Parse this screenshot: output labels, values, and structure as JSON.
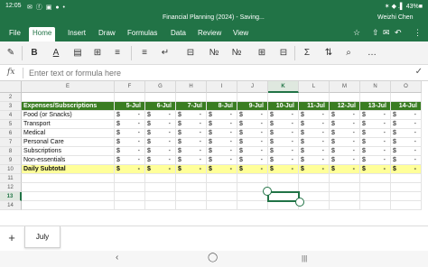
{
  "status": {
    "time": "12:05",
    "icons": "✉ ⓕ ▣ ● •",
    "right": "✶ ◆ .▌ 43%■"
  },
  "title": {
    "doc": "Financial Planning (2024) - Saving...",
    "user": "Weizhi Chen"
  },
  "tabs": [
    "File",
    "Home",
    "Insert",
    "Draw",
    "Formulas",
    "Data",
    "Review",
    "View"
  ],
  "active_tab": "Home",
  "toolbar_icons": {
    "lightbulb": "☆",
    "share": "⇧",
    "comment": "✉",
    "undo": "↶",
    "more": "⋮",
    "paint": "✎",
    "bold": "B",
    "underline": "A",
    "fill": "▤",
    "borders": "⊞",
    "align": "≡",
    "wrap": "↵",
    "merge": "⊟",
    "number": "№",
    "insert": "⊞",
    "delete": "⊟",
    "sum": "Σ",
    "sort": "⇅",
    "find": "⌕",
    "more2": "…"
  },
  "formula_bar": {
    "fx": "fx",
    "placeholder": "Enter text or formula here",
    "check": "✓"
  },
  "columns": [
    "E",
    "F",
    "G",
    "H",
    "I",
    "J",
    "K",
    "L",
    "M",
    "N",
    "O"
  ],
  "selected_column": "K",
  "rows": [
    "2",
    "3",
    "4",
    "5",
    "6",
    "7",
    "8",
    "9",
    "10",
    "11",
    "12",
    "13",
    "14"
  ],
  "selected_row": "13",
  "header_row": {
    "label": "Expenses/Subscriptions",
    "dates": [
      "5-Jul",
      "6-Jul",
      "7-Jul",
      "8-Jul",
      "9-Jul",
      "10-Jul",
      "11-Jul",
      "12-Jul",
      "13-Jul",
      "14-Jul"
    ]
  },
  "expense_rows": [
    {
      "label": "Food (or Snacks)",
      "cells": [
        "$ -",
        "$ -",
        "$ -",
        "$ -",
        "$ -",
        "$ -",
        "$ -",
        "$ -",
        "$ -",
        "$ -"
      ]
    },
    {
      "label": "Transport",
      "cells": [
        "$ -",
        "$ -",
        "$ -",
        "$ -",
        "$ -",
        "$ -",
        "$ -",
        "$ -",
        "$ -",
        "$ -"
      ]
    },
    {
      "label": "Medical",
      "cells": [
        "$ -",
        "$ -",
        "$ -",
        "$ -",
        "$ -",
        "$ -",
        "$ -",
        "$ -",
        "$ -",
        "$ -"
      ]
    },
    {
      "label": "Personal Care",
      "cells": [
        "$ -",
        "$ -",
        "$ -",
        "$ -",
        "$ -",
        "$ -",
        "$ -",
        "$ -",
        "$ -",
        "$ -"
      ]
    },
    {
      "label": "Subscriptions",
      "cells": [
        "$ -",
        "$ -",
        "$ -",
        "$ -",
        "$ -",
        "$ -",
        "$ -",
        "$ -",
        "$ -",
        "$ -"
      ]
    },
    {
      "label": "Non-essentials",
      "cells": [
        "$ -",
        "$ -",
        "$ -",
        "$ -",
        "$ -",
        "$ -",
        "$ -",
        "$ -",
        "$ -",
        "$ -"
      ]
    }
  ],
  "subtotal_row": {
    "label": "Daily Subtotal",
    "cells": [
      "$ -",
      "$ -",
      "$ -",
      "$ -",
      "$ -",
      "$ -",
      "$ -",
      "$ -",
      "$ -",
      "$ -"
    ]
  },
  "currency": "$",
  "dash": "-",
  "sheet": {
    "add": "+",
    "name": "July"
  },
  "nav": {
    "back": "‹",
    "home": "◯",
    "recents": "|||"
  },
  "colors": {
    "accent": "#217346",
    "header_fill": "#3a7d22",
    "subtotal_fill": "#ffff99"
  }
}
